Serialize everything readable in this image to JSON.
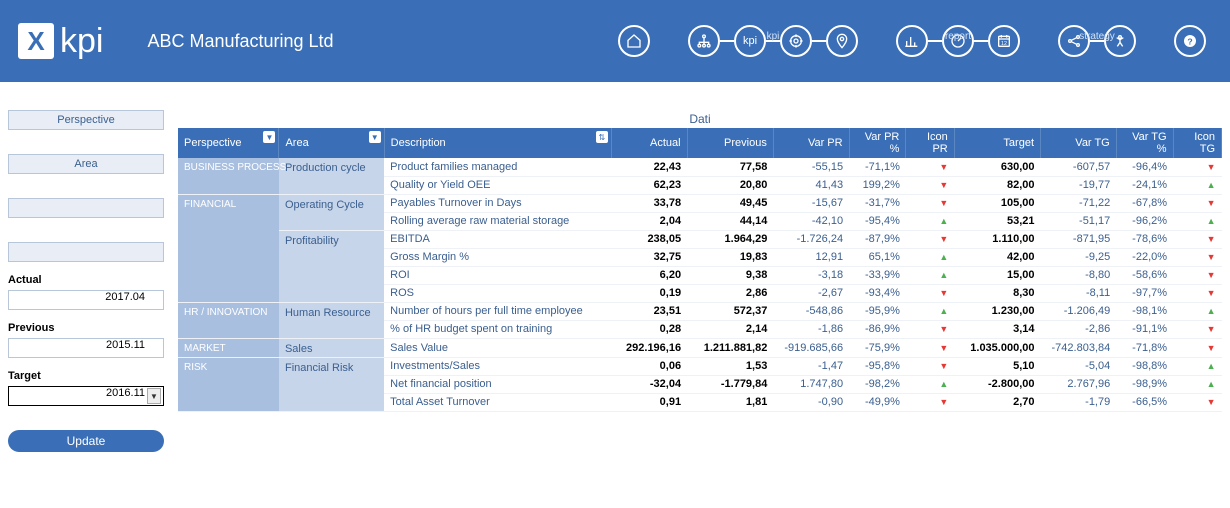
{
  "header": {
    "logo_text": "kpi",
    "company": "ABC Manufacturing Ltd",
    "groups": {
      "kpi": "kpi",
      "report": "report",
      "strategy": "strategy"
    }
  },
  "sidebar": {
    "perspective_label": "Perspective",
    "area_label": "Area",
    "actual_label": "Actual",
    "actual_value": "2017.04",
    "previous_label": "Previous",
    "previous_value": "2015.11",
    "target_label": "Target",
    "target_value": "2016.11",
    "update_label": "Update"
  },
  "table": {
    "title": "Dati",
    "headers": {
      "perspective": "Perspective",
      "area": "Area",
      "description": "Description",
      "actual": "Actual",
      "previous": "Previous",
      "var_pr": "Var PR",
      "var_pr_pct": "Var PR %",
      "icon_pr": "Icon PR",
      "target": "Target",
      "var_tg": "Var TG",
      "var_tg_pct": "Var TG %",
      "icon_tg": "Icon TG"
    },
    "rows": [
      {
        "perspective": "BUSINESS PROCESS",
        "perspective_rows": 2,
        "area": "Production cycle",
        "area_rows": 2,
        "desc": "Product families managed",
        "actual": "22,43",
        "previous": "77,58",
        "var_pr": "-55,15",
        "var_pr_pct": "-71,1%",
        "icon_pr": "down",
        "target": "630,00",
        "var_tg": "-607,57",
        "var_tg_pct": "-96,4%",
        "icon_tg": "down"
      },
      {
        "desc": "Quality or Yield OEE",
        "actual": "62,23",
        "previous": "20,80",
        "var_pr": "41,43",
        "var_pr_pct": "199,2%",
        "icon_pr": "down",
        "target": "82,00",
        "var_tg": "-19,77",
        "var_tg_pct": "-24,1%",
        "icon_tg": "up"
      },
      {
        "perspective": "FINANCIAL",
        "perspective_rows": 6,
        "area": "Operating Cycle",
        "area_rows": 2,
        "desc": "Payables Turnover in Days",
        "actual": "33,78",
        "previous": "49,45",
        "var_pr": "-15,67",
        "var_pr_pct": "-31,7%",
        "icon_pr": "down",
        "target": "105,00",
        "var_tg": "-71,22",
        "var_tg_pct": "-67,8%",
        "icon_tg": "down"
      },
      {
        "desc": "Rolling average raw material storage",
        "actual": "2,04",
        "previous": "44,14",
        "var_pr": "-42,10",
        "var_pr_pct": "-95,4%",
        "icon_pr": "up",
        "target": "53,21",
        "var_tg": "-51,17",
        "var_tg_pct": "-96,2%",
        "icon_tg": "up"
      },
      {
        "area": "Profitability",
        "area_rows": 4,
        "desc": "EBITDA",
        "actual": "238,05",
        "previous": "1.964,29",
        "var_pr": "-1.726,24",
        "var_pr_pct": "-87,9%",
        "icon_pr": "down",
        "target": "1.110,00",
        "var_tg": "-871,95",
        "var_tg_pct": "-78,6%",
        "icon_tg": "down"
      },
      {
        "desc": "Gross Margin %",
        "actual": "32,75",
        "previous": "19,83",
        "var_pr": "12,91",
        "var_pr_pct": "65,1%",
        "icon_pr": "up",
        "target": "42,00",
        "var_tg": "-9,25",
        "var_tg_pct": "-22,0%",
        "icon_tg": "down"
      },
      {
        "desc": "ROI",
        "actual": "6,20",
        "previous": "9,38",
        "var_pr": "-3,18",
        "var_pr_pct": "-33,9%",
        "icon_pr": "up",
        "target": "15,00",
        "var_tg": "-8,80",
        "var_tg_pct": "-58,6%",
        "icon_tg": "down"
      },
      {
        "desc": "ROS",
        "actual": "0,19",
        "previous": "2,86",
        "var_pr": "-2,67",
        "var_pr_pct": "-93,4%",
        "icon_pr": "down",
        "target": "8,30",
        "var_tg": "-8,11",
        "var_tg_pct": "-97,7%",
        "icon_tg": "down"
      },
      {
        "perspective": "HR / INNOVATION",
        "perspective_rows": 2,
        "area": "Human Resource",
        "area_rows": 2,
        "desc": "Number of hours per full time employee",
        "actual": "23,51",
        "previous": "572,37",
        "var_pr": "-548,86",
        "var_pr_pct": "-95,9%",
        "icon_pr": "up",
        "target": "1.230,00",
        "var_tg": "-1.206,49",
        "var_tg_pct": "-98,1%",
        "icon_tg": "up"
      },
      {
        "desc": "% of HR budget spent on training",
        "actual": "0,28",
        "previous": "2,14",
        "var_pr": "-1,86",
        "var_pr_pct": "-86,9%",
        "icon_pr": "down",
        "target": "3,14",
        "var_tg": "-2,86",
        "var_tg_pct": "-91,1%",
        "icon_tg": "down"
      },
      {
        "perspective": "MARKET",
        "perspective_rows": 1,
        "area": "Sales",
        "area_rows": 1,
        "desc": "Sales Value",
        "actual": "292.196,16",
        "previous": "1.211.881,82",
        "var_pr": "-919.685,66",
        "var_pr_pct": "-75,9%",
        "icon_pr": "down",
        "target": "1.035.000,00",
        "var_tg": "-742.803,84",
        "var_tg_pct": "-71,8%",
        "icon_tg": "down"
      },
      {
        "perspective": "RISK",
        "perspective_rows": 3,
        "area": "Financial Risk",
        "area_rows": 3,
        "desc": "Investments/Sales",
        "actual": "0,06",
        "previous": "1,53",
        "var_pr": "-1,47",
        "var_pr_pct": "-95,8%",
        "icon_pr": "down",
        "target": "5,10",
        "var_tg": "-5,04",
        "var_tg_pct": "-98,8%",
        "icon_tg": "up"
      },
      {
        "desc": "Net financial position",
        "actual": "-32,04",
        "previous": "-1.779,84",
        "var_pr": "1.747,80",
        "var_pr_pct": "-98,2%",
        "icon_pr": "up",
        "target": "-2.800,00",
        "var_tg": "2.767,96",
        "var_tg_pct": "-98,9%",
        "icon_tg": "up"
      },
      {
        "desc": "Total Asset Turnover",
        "actual": "0,91",
        "previous": "1,81",
        "var_pr": "-0,90",
        "var_pr_pct": "-49,9%",
        "icon_pr": "down",
        "target": "2,70",
        "var_tg": "-1,79",
        "var_tg_pct": "-66,5%",
        "icon_tg": "down"
      }
    ]
  }
}
